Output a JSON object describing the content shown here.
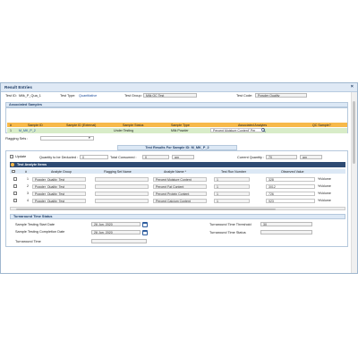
{
  "window": {
    "title": "Result Entries",
    "close_label": "×"
  },
  "header": {
    "test_id_label": "Test ID:",
    "test_id_value": "Milk_P_Qua_1",
    "test_type_label": "Test Type:",
    "test_type_value": "Quantitative",
    "test_group_label": "Test Group:",
    "test_group_value": "Milk QC Test",
    "test_code_label": "Test Code:",
    "test_code_value": "Powder Quality"
  },
  "associated_samples": {
    "section_title": "Associated Samples",
    "columns": [
      "#",
      "Sample ID",
      "Sample ID (External)",
      "Sample Status",
      "Sample Type",
      "Associated Analytes",
      "QC Sample?"
    ],
    "rows": [
      {
        "index": "1",
        "sample_id": "M_MK_P_2",
        "sample_id_external": "",
        "status": "Under Testing",
        "type": "Milk Powder",
        "analytes": "Percent Moisture Content\" Per",
        "qc": ""
      }
    ]
  },
  "flagging_set": {
    "label": "Flagging Sets :",
    "value": ""
  },
  "test_results": {
    "banner": "Test Results For Sample ID: M_MK_P_2",
    "update_label": "Update",
    "qty_deducted_label": "Quantity to be Deducted :",
    "qty_deducted_value": "0",
    "qty_deducted_unit": "gm",
    "total_consumed_label": "Total Consumed :",
    "total_consumed_value": "0",
    "total_consumed_unit": "gm",
    "current_qty_label": "Current Quantity :",
    "current_qty_value": "70",
    "current_qty_unit": "gm"
  },
  "analyte_table": {
    "title": "Test Analyte Items",
    "columns": [
      "#",
      "Analyte Group",
      "Flagging Set Name",
      "Analyte Name *",
      "Test Run Number",
      "Observed Value"
    ],
    "rows": [
      {
        "index": "1",
        "group": "Powder_Quality_Test",
        "flagging": "",
        "analyte": "Percent Moisture Content",
        "run": "1",
        "value": "328",
        "unit": "%Volume"
      },
      {
        "index": "2",
        "group": "Powder_Quality_Test",
        "flagging": "",
        "analyte": "Percent Fat Content",
        "run": "1",
        "value": "3012",
        "unit": "%Volume"
      },
      {
        "index": "3",
        "group": "Powder_Quality_Test",
        "flagging": "",
        "analyte": "Percent Protein Content",
        "run": "1",
        "value": "726",
        "unit": "%Volume"
      },
      {
        "index": "4",
        "group": "Powder_Quality_Test",
        "flagging": "",
        "analyte": "Percent Calcium Content",
        "run": "1",
        "value": "923",
        "unit": "%Volume"
      }
    ]
  },
  "turnaround": {
    "section_title": "Turnaround Time Status",
    "start_date_label": "Sample Testing Start Date",
    "start_date_value": "26 Jun, 2020",
    "completion_date_label": "Sample Testing Completion Date",
    "completion_date_value": "26 Jun, 2020",
    "tat_label": "Turnaround Time",
    "tat_value": "",
    "threshold_label": "Turnaround Time Threshold",
    "threshold_value": "30",
    "status_label": "Turnaround Time Status",
    "status_value": ""
  },
  "colors": {
    "header_orange": "#f7b94a",
    "row_green": "#d8ecc8",
    "dark_navy": "#2e4b73",
    "section_blue": "#dce8f5"
  }
}
